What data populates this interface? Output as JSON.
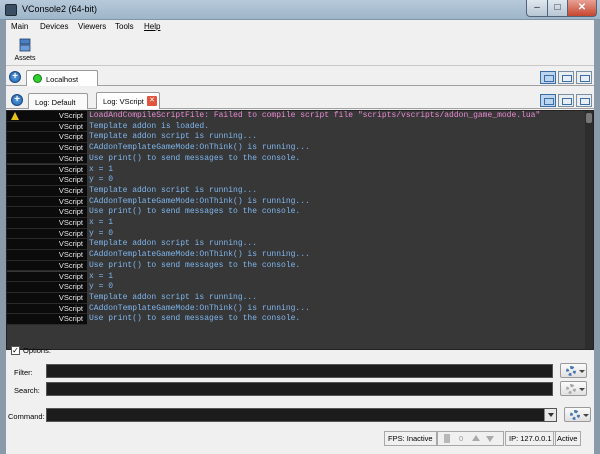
{
  "window": {
    "title": "VConsole2 (64-bit)",
    "min": "–",
    "max": "□",
    "close": "✕"
  },
  "menu": [
    "Main",
    "Devices",
    "Viewers",
    "Tools",
    "Help"
  ],
  "toolbar": {
    "assets_label": "Assets"
  },
  "connection_tabs": {
    "add": "+",
    "tabs": [
      {
        "label": "Localhost"
      }
    ]
  },
  "log_tabs": {
    "add": "+",
    "tabs": [
      {
        "label": "Log: Default"
      },
      {
        "label": "Log: VScript",
        "close": "✕"
      }
    ]
  },
  "console": {
    "rows": [
      {
        "source": "VScript",
        "text": "LoadAndCompileScriptFile: Failed to compile script file \"scripts/vscripts/addon_game_mode.lua\"",
        "level": "warning"
      },
      {
        "source": "VScript",
        "text": "Template addon is loaded."
      },
      {
        "source": "VScript",
        "text": "Template addon script is running..."
      },
      {
        "source": "VScript",
        "text": "CAddonTemplateGameMode:OnThink() is running..."
      },
      {
        "source": "VScript",
        "text": "Use print() to send messages to the console."
      },
      {
        "source": "VScript",
        "text": "x = 1"
      },
      {
        "source": "VScript",
        "text": "y = 0"
      },
      {
        "source": "VScript",
        "text": "Template addon script is running..."
      },
      {
        "source": "VScript",
        "text": "CAddonTemplateGameMode:OnThink() is running..."
      },
      {
        "source": "VScript",
        "text": "Use print() to send messages to the console."
      },
      {
        "source": "VScript",
        "text": "x = 1"
      },
      {
        "source": "VScript",
        "text": "y = 0"
      },
      {
        "source": "VScript",
        "text": "Template addon script is running..."
      },
      {
        "source": "VScript",
        "text": "CAddonTemplateGameMode:OnThink() is running..."
      },
      {
        "source": "VScript",
        "text": "Use print() to send messages to the console."
      },
      {
        "source": "VScript",
        "text": "x = 1"
      },
      {
        "source": "VScript",
        "text": "y = 0"
      },
      {
        "source": "VScript",
        "text": "Template addon script is running..."
      },
      {
        "source": "VScript",
        "text": "CAddonTemplateGameMode:OnThink() is running..."
      },
      {
        "source": "VScript",
        "text": "Use print() to send messages to the console."
      }
    ],
    "colors": {
      "warning": "#e98ad3",
      "info": "#7fb6ee"
    }
  },
  "options": {
    "checked": "✓",
    "label": "Options:"
  },
  "filter": {
    "label": "Filter:",
    "value": ""
  },
  "search": {
    "label": "Search:",
    "value": ""
  },
  "command": {
    "label": "Command:",
    "value": ""
  },
  "status": {
    "fps": "FPS: Inactive",
    "count": "0",
    "ip": "IP: 127.0.0.1",
    "state": "Active"
  },
  "icons": [
    "app-icon",
    "assets-icon",
    "add-icon",
    "connection-status-icon",
    "warning-icon",
    "gear-icon",
    "bookmark-icon",
    "arrow-up-icon",
    "arrow-down-icon",
    "layout-icon"
  ]
}
